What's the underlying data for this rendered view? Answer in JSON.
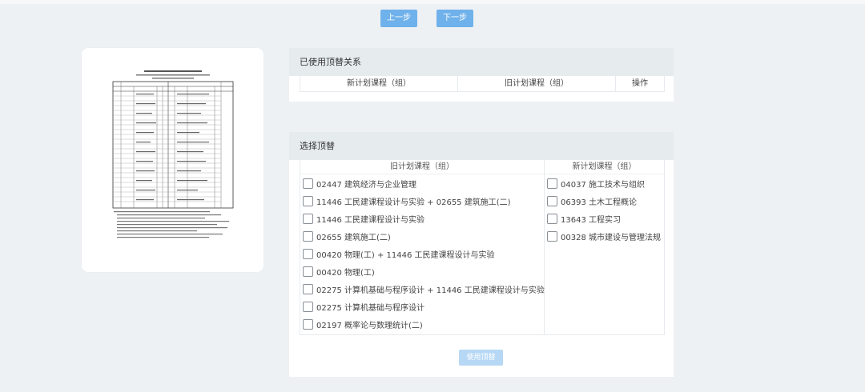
{
  "nav": {
    "prev_label": "上一步",
    "next_label": "下一步"
  },
  "used_panel": {
    "title": "已使用顶替关系",
    "columns": [
      "新计划课程（组）",
      "旧计划课程（组）",
      "操作"
    ]
  },
  "select_panel": {
    "title": "选择顶替",
    "old_header": "旧计划课程（组）",
    "new_header": "新计划课程（组）",
    "old_items": [
      "02447 建筑经济与企业管理",
      "11446 工民建课程设计与实验 + 02655 建筑施工(二)",
      "11446 工民建课程设计与实验",
      "02655 建筑施工(二)",
      "00420 物理(工) + 11446 工民建课程设计与实验",
      "00420 物理(工)",
      "02275 计算机基础与程序设计 + 11446 工民建课程设计与实验",
      "02275 计算机基础与程序设计",
      "02197 概率论与数理统计(二)"
    ],
    "new_items": [
      "04037 施工技术与组织",
      "06393 土木工程概论",
      "13643 工程实习",
      "00328 城市建设与管理法规"
    ],
    "apply_label": "使用顶替"
  },
  "colors": {
    "accent": "#6fb1ea",
    "accent_disabled": "#b7d8f5",
    "panel_header": "#e6ebee"
  }
}
